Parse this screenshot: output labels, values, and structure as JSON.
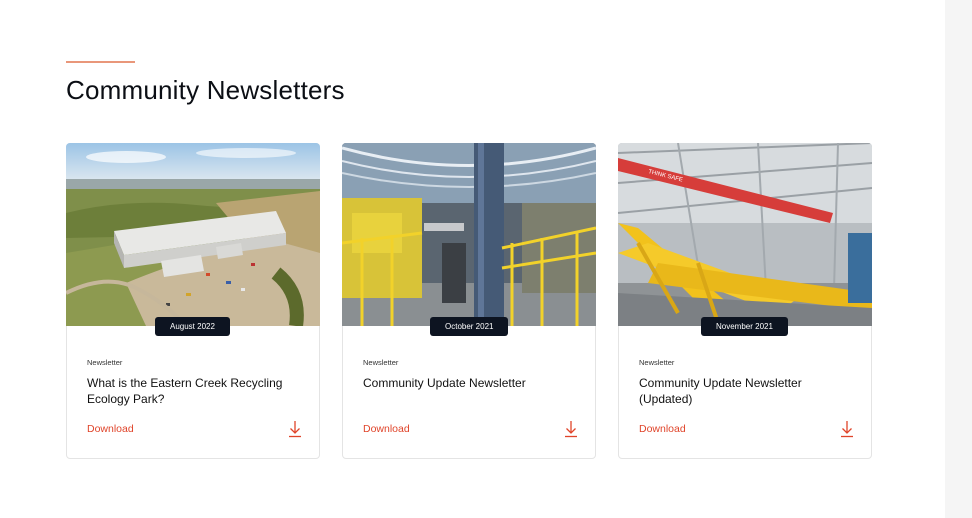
{
  "section": {
    "title": "Community Newsletters"
  },
  "cards": [
    {
      "date": "August 2022",
      "category": "Newsletter",
      "title": "What is the Eastern Creek Recycling Ecology Park?",
      "download_label": "Download",
      "image": "aerial-view-of-recycling-facility"
    },
    {
      "date": "October 2021",
      "category": "Newsletter",
      "title": "Community Update Newsletter",
      "download_label": "Download",
      "image": "interior-processing-hall-with-yellow-railings"
    },
    {
      "date": "November 2021",
      "category": "Newsletter",
      "title": "Community Update Newsletter (Updated)",
      "download_label": "Download",
      "image": "interior-with-yellow-conveyors"
    }
  ],
  "colors": {
    "accent": "#e0442a",
    "accent_line": "#e9977a",
    "badge_bg": "#0d1421",
    "card_border": "#e4e4e4"
  },
  "icons": {
    "download": "arrow-down-to-line-icon"
  }
}
